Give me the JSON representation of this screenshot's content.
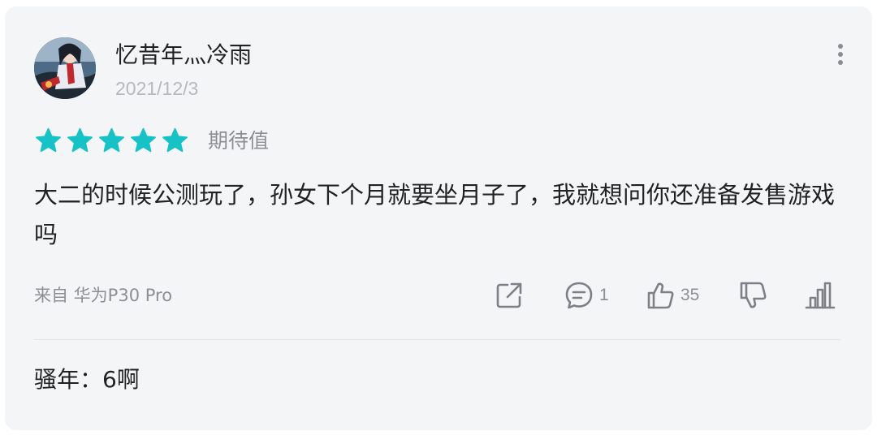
{
  "review": {
    "username": "忆昔年灬冷雨",
    "date": "2021/12/3",
    "rating": 5,
    "rating_max": 5,
    "rating_label": "期待值",
    "content": "大二的时候公测玩了，孙女下个月就要坐月子了，我就想问你还准备发售游戏吗",
    "device": "来自 华为P30 Pro"
  },
  "actions": {
    "share_icon": "share-icon",
    "comment_icon": "comment-icon",
    "comment_count": "1",
    "like_icon": "thumbs-up-icon",
    "like_count": "35",
    "dislike_icon": "thumbs-down-icon",
    "chart_icon": "bar-chart-icon"
  },
  "reply": {
    "text": "骚年：6啊"
  },
  "colors": {
    "card_bg": "#f4f5f7",
    "star": "#17c2c7",
    "secondary_text": "#8c8f94",
    "date_text": "#b5b8bd",
    "primary_text": "#222222"
  }
}
